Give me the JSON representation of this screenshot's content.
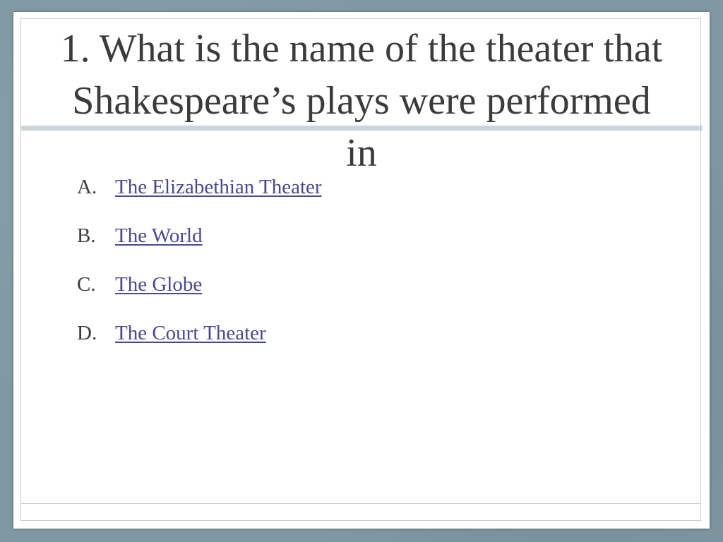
{
  "slide": {
    "title": "1. What is the name of the theater that Shakespeare’s plays were performed in",
    "answers": [
      {
        "letter": "A.",
        "text": "The Elizabethian Theater"
      },
      {
        "letter": "B.",
        "text": "The World"
      },
      {
        "letter": "C.",
        "text": "The Globe"
      },
      {
        "letter": "D.",
        "text": "The Court Theater"
      }
    ]
  },
  "colors": {
    "background": "#7f98a3",
    "slide": "#ffffff",
    "title_text": "#3b3b3b",
    "link": "#4b4790",
    "rule": "#cdd4d8"
  }
}
